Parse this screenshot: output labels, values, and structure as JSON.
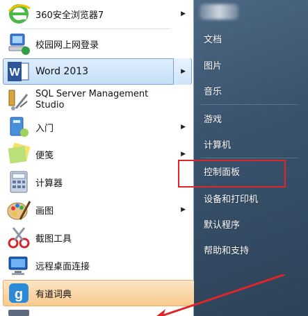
{
  "programs": [
    {
      "label": "360安全浏览器7",
      "icon": "ie-green-e-icon",
      "has_submenu": true
    },
    {
      "label": "校园网上网登录",
      "icon": "network-login-icon",
      "has_submenu": false
    },
    {
      "label": "Word 2013",
      "icon": "word-icon",
      "has_submenu": true
    },
    {
      "label": "SQL Server Management Studio",
      "icon": "sql-server-icon",
      "has_submenu": false
    },
    {
      "label": "入门",
      "icon": "getting-started-icon",
      "has_submenu": true
    },
    {
      "label": "便笺",
      "icon": "sticky-notes-icon",
      "has_submenu": true
    },
    {
      "label": "计算器",
      "icon": "calculator-icon",
      "has_submenu": false
    },
    {
      "label": "画图",
      "icon": "paint-icon",
      "has_submenu": true
    },
    {
      "label": "截图工具",
      "icon": "snipping-tool-icon",
      "has_submenu": false
    },
    {
      "label": "远程桌面连接",
      "icon": "remote-desktop-icon",
      "has_submenu": false
    },
    {
      "label": "有道词典",
      "icon": "youdao-dict-icon",
      "has_submenu": false
    }
  ],
  "right_menu": [
    "文档",
    "图片",
    "音乐",
    "游戏",
    "计算机",
    "控制面板",
    "设备和打印机",
    "默认程序",
    "帮助和支持"
  ],
  "word_icon_letter": "W",
  "youdao_icon_text": "g"
}
